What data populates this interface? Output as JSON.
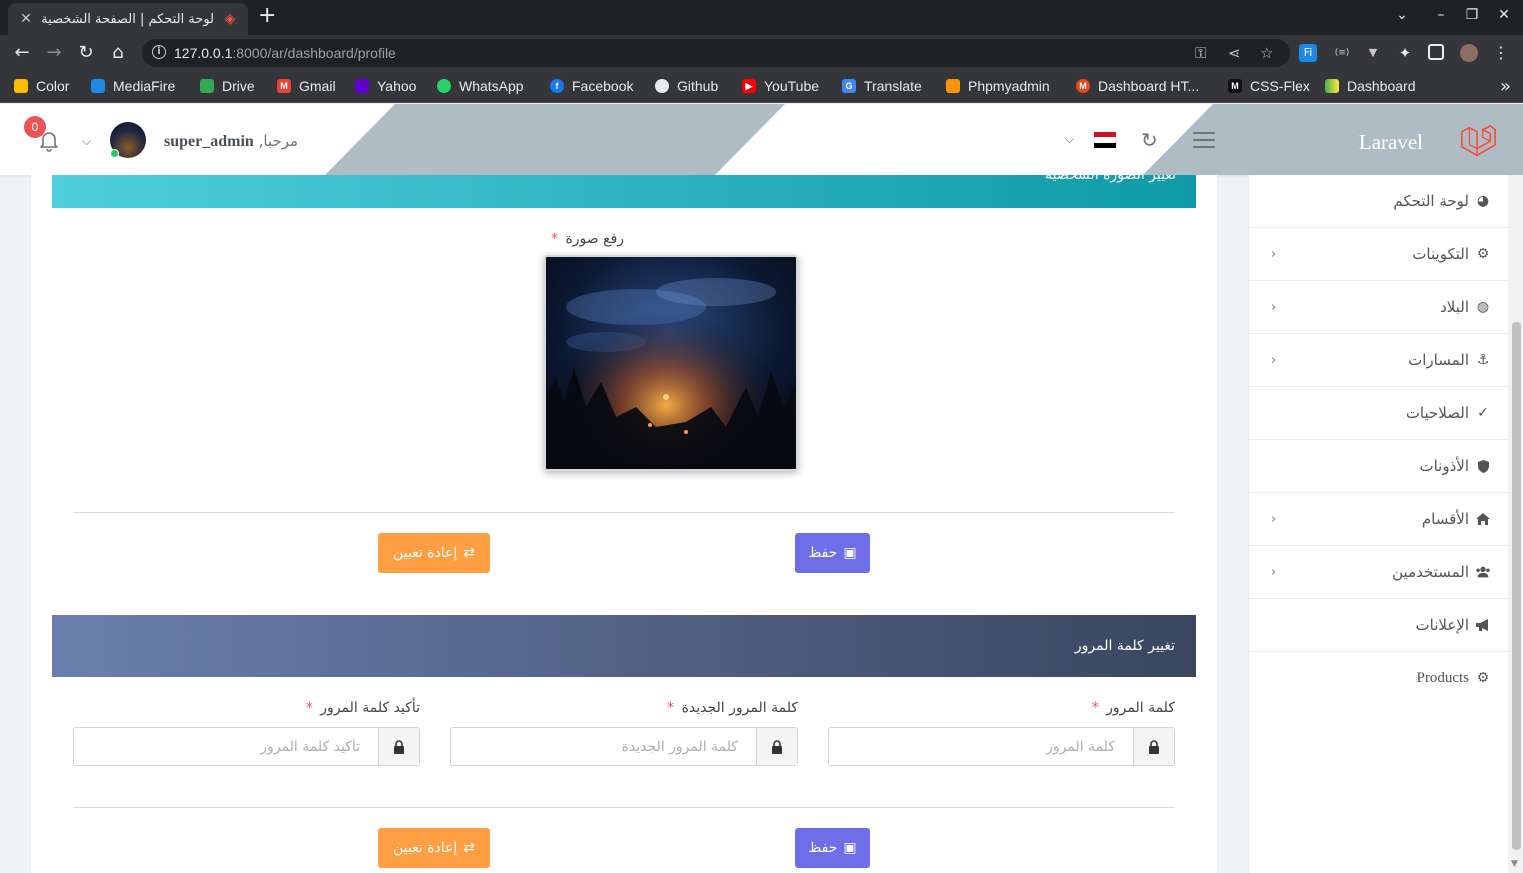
{
  "browser": {
    "tab_title": "لوحة التحكم | الصفحة الشخصية",
    "url_host": "127.0.0.1",
    "url_path": ":8000/ar/dashboard/profile",
    "bookmarks": [
      "Color",
      "MediaFire",
      "Drive",
      "Gmail",
      "Yahoo",
      "WhatsApp",
      "Facebook",
      "Github",
      "YouTube",
      "Translate",
      "Phpmyadmin",
      "Dashboard HT...",
      "CSS-Flex",
      "Dashboard"
    ]
  },
  "header": {
    "brand": "Laravel",
    "welcome": "مرحبا,",
    "username": "super_admin",
    "notification_count": "0"
  },
  "profile_section": {
    "title": "تغيير الصورة الشخصية",
    "upload_label": "رفع صورة",
    "required_mark": "*",
    "save_label": "حفظ",
    "reset_label": "إعادة تعيين"
  },
  "password_section": {
    "title": "تغيير كلمة المرور",
    "fields": [
      {
        "label": "كلمة المرور",
        "placeholder": "كلمة المرور",
        "value": ""
      },
      {
        "label": "كلمة المرور الجديدة",
        "placeholder": "كلمة المرور الجديدة",
        "value": ""
      },
      {
        "label": "تأكيد كلمة المرور",
        "placeholder": "تأكيد كلمة المرور",
        "value": ""
      }
    ],
    "save_label": "حفظ",
    "reset_label": "إعادة تعيين"
  },
  "sidebar": {
    "items": [
      {
        "label": "لوحة التحكم",
        "icon": "dashboard-icon",
        "has_children": false
      },
      {
        "label": "التكوينات",
        "icon": "cogs-icon",
        "has_children": true
      },
      {
        "label": "البلاد",
        "icon": "globe-icon",
        "has_children": true
      },
      {
        "label": "المسارات",
        "icon": "anchor-icon",
        "has_children": true
      },
      {
        "label": "الصلاحيات",
        "icon": "check-icon",
        "has_children": false
      },
      {
        "label": "الأذونات",
        "icon": "shield-icon",
        "has_children": false
      },
      {
        "label": "الأقسام",
        "icon": "home-icon",
        "has_children": true
      },
      {
        "label": "المستخدمين",
        "icon": "users-icon",
        "has_children": true
      },
      {
        "label": "الإعلانات",
        "icon": "bullhorn-icon",
        "has_children": false
      },
      {
        "label": "Products",
        "icon": "cogs-icon",
        "has_children": false
      }
    ]
  },
  "colors": {
    "sidebar_header": "#b0bcc3",
    "section1_gradient": [
      "#4fcfdc",
      "#0e9aa7"
    ],
    "section2_gradient": [
      "#6b7fae",
      "#3a4660"
    ],
    "save_button": "#6e6ee8",
    "reset_button": "#ff9f43",
    "badge": "#ea5455"
  }
}
